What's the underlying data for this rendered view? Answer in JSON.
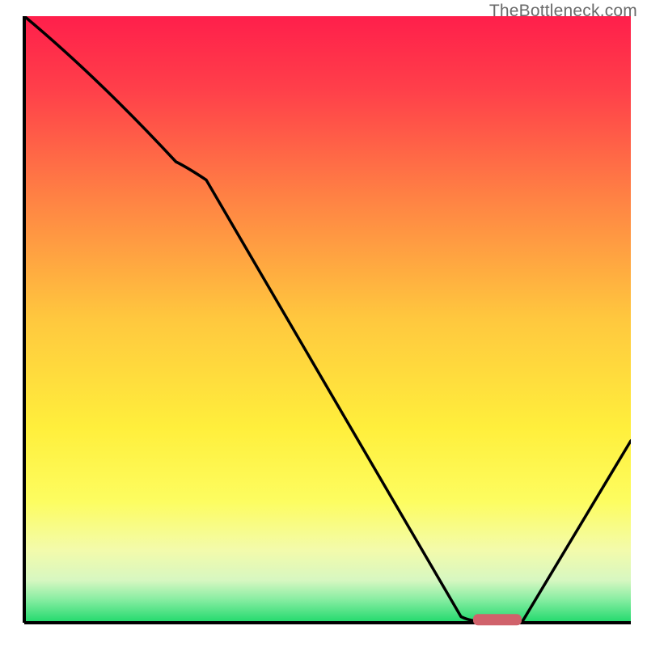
{
  "watermark": "TheBottleneck.com",
  "chart_data": {
    "type": "line",
    "title": "",
    "xlabel": "",
    "ylabel": "",
    "xlim": [
      0,
      100
    ],
    "ylim": [
      0,
      100
    ],
    "x": [
      0,
      25,
      30,
      72,
      78,
      82,
      100
    ],
    "y": [
      100,
      76,
      73,
      1,
      0,
      0,
      30
    ],
    "note": "Black curve over vertical gradient; values approximate, read from pixel positions. y=0 is the green band at bottom, y=100 is top.",
    "marker": {
      "x_start": 74,
      "x_end": 82,
      "y": 0.5,
      "color": "#d0626b",
      "shape": "rounded-bar"
    },
    "gradient_stops": [
      {
        "pct": 0,
        "color": "#ff1f4b"
      },
      {
        "pct": 12,
        "color": "#ff3f4a"
      },
      {
        "pct": 30,
        "color": "#ff8244"
      },
      {
        "pct": 50,
        "color": "#ffc83e"
      },
      {
        "pct": 68,
        "color": "#ffef3c"
      },
      {
        "pct": 80,
        "color": "#fdfd60"
      },
      {
        "pct": 88,
        "color": "#f3fbab"
      },
      {
        "pct": 93,
        "color": "#d7f7c1"
      },
      {
        "pct": 96,
        "color": "#8ceea4"
      },
      {
        "pct": 100,
        "color": "#1fd96c"
      }
    ]
  }
}
